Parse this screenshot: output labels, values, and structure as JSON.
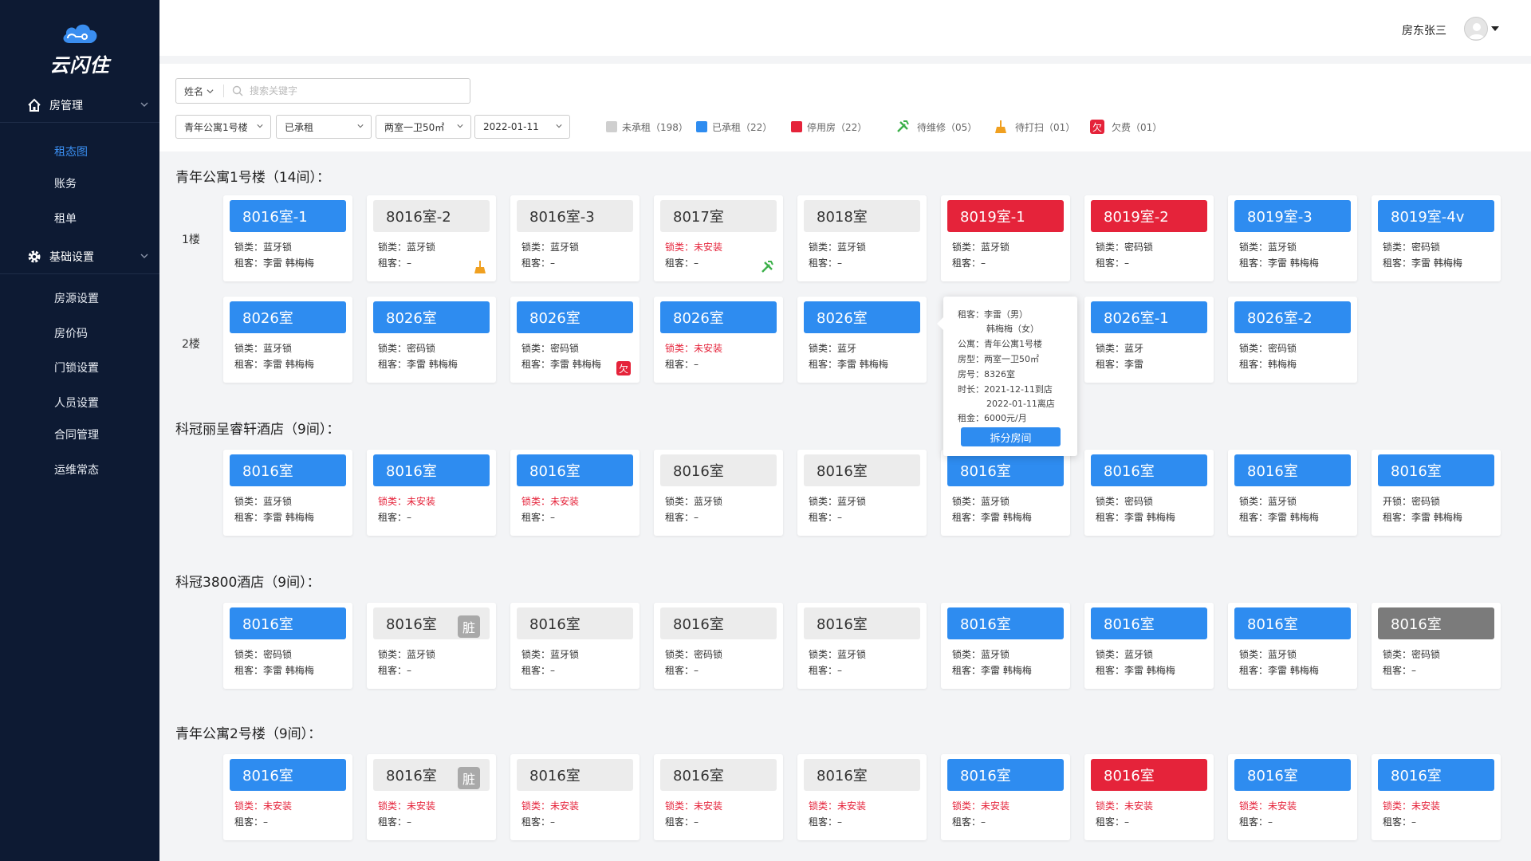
{
  "app": {
    "logo_text": "云闪住"
  },
  "sidebar": {
    "groups": [
      {
        "label": "房管理",
        "icon": "home-icon"
      },
      {
        "label": "基础设置",
        "icon": "gear-icon"
      }
    ],
    "room_items": [
      "租态图",
      "账务",
      "租单"
    ],
    "setting_items": [
      "房源设置",
      "房价码",
      "门锁设置",
      "人员设置",
      "合同管理",
      "运维常态"
    ]
  },
  "header": {
    "user": "房东张三"
  },
  "filters": {
    "search_type": "姓名",
    "search_placeholder": "搜索关键字",
    "selects": [
      "青年公寓1号楼",
      "已承租",
      "两室一卫50㎡",
      "2022-01-11"
    ],
    "legend": [
      {
        "label": "未承租（198）",
        "color": "#cfcfcf"
      },
      {
        "label": "已承租（22）",
        "color": "#2e8cf0"
      },
      {
        "label": "停用房（22）",
        "color": "#e5233a"
      },
      {
        "label": "待维修（05）",
        "icon": "tools-icon"
      },
      {
        "label": "待打扫（01）",
        "icon": "broom-icon"
      },
      {
        "label": "欠费（01）",
        "icon": "arrears-icon",
        "badge": "欠"
      }
    ]
  },
  "labels": {
    "lock": "锁类：",
    "tenant": "租客：",
    "open_lock": "开锁：",
    "floor1": "1楼",
    "floor2": "2楼",
    "dirty": "脏",
    "arrears": "欠"
  },
  "sections": [
    {
      "title": "青年公寓1号楼（14间）：",
      "floors": [
        {
          "rooms": [
            {
              "name": "8016室-1",
              "status": "blue",
              "lock": "蓝牙锁",
              "tenant": "李雷 韩梅梅"
            },
            {
              "name": "8016室-2",
              "status": "gray",
              "lock": "蓝牙锁",
              "tenant": "–",
              "icon": "broom-icon"
            },
            {
              "name": "8016室-3",
              "status": "gray",
              "lock": "蓝牙锁",
              "tenant": "–"
            },
            {
              "name": "8017室",
              "status": "gray",
              "lock": "未安装",
              "lock_warn": true,
              "tenant": "–",
              "icon": "tools-icon"
            },
            {
              "name": "8018室",
              "status": "gray",
              "lock": "蓝牙锁",
              "tenant": "–"
            },
            {
              "name": "8019室-1",
              "status": "red",
              "lock": "蓝牙锁",
              "tenant": "–"
            },
            {
              "name": "8019室-2",
              "status": "red",
              "lock": "密码锁",
              "tenant": "–"
            },
            {
              "name": "8019室-3",
              "status": "blue",
              "lock": "蓝牙锁",
              "tenant": "李雷 韩梅梅"
            },
            {
              "name": "8019室-4v",
              "status": "blue",
              "lock": "密码锁",
              "tenant": "李雷 韩梅梅"
            }
          ]
        },
        {
          "rooms": [
            {
              "name": "8026室",
              "status": "blue",
              "lock": "蓝牙锁",
              "tenant": "李雷 韩梅梅"
            },
            {
              "name": "8026室",
              "status": "blue",
              "lock": "密码锁",
              "tenant": "李雷 韩梅梅"
            },
            {
              "name": "8026室",
              "status": "blue",
              "lock": "密码锁",
              "tenant": "李雷 韩梅梅",
              "icon": "arrears-icon"
            },
            {
              "name": "8026室",
              "status": "blue",
              "lock": "未安装",
              "lock_warn": true,
              "tenant": "–"
            },
            {
              "name": "8026室",
              "status": "blue",
              "lock": "蓝牙",
              "tenant": "李雷 韩梅梅"
            },
            null,
            {
              "name": "8026室-1",
              "status": "blue",
              "lock": "蓝牙",
              "tenant": "李雷"
            },
            {
              "name": "8026室-2",
              "status": "blue",
              "lock": "密码锁",
              "tenant": "韩梅梅"
            }
          ]
        }
      ]
    },
    {
      "title": "科冠丽呈睿轩酒店（9间）：",
      "floors": [
        {
          "rooms": [
            {
              "name": "8016室",
              "status": "blue",
              "lock": "蓝牙锁",
              "tenant": "李雷 韩梅梅"
            },
            {
              "name": "8016室",
              "status": "blue",
              "lock": "未安装",
              "lock_warn": true,
              "tenant": "–"
            },
            {
              "name": "8016室",
              "status": "blue",
              "lock": "未安装",
              "lock_warn": true,
              "tenant": "–"
            },
            {
              "name": "8016室",
              "status": "gray",
              "lock": "蓝牙锁",
              "tenant": "–"
            },
            {
              "name": "8016室",
              "status": "gray",
              "lock": "蓝牙锁",
              "tenant": "–"
            },
            {
              "name": "8016室",
              "status": "blue",
              "lock": "蓝牙锁",
              "tenant": "李雷 韩梅梅"
            },
            {
              "name": "8016室",
              "status": "blue",
              "lock": "密码锁",
              "tenant": "李雷 韩梅梅"
            },
            {
              "name": "8016室",
              "status": "blue",
              "lock": "蓝牙锁",
              "tenant": "李雷 韩梅梅"
            },
            {
              "name": "8016室",
              "status": "blue",
              "lock": "密码锁",
              "tenant": "李雷 韩梅梅",
              "open": true
            }
          ]
        }
      ]
    },
    {
      "title": "科冠3800酒店（9间）：",
      "floors": [
        {
          "rooms": [
            {
              "name": "8016室",
              "status": "blue",
              "lock": "密码锁",
              "tenant": "李雷 韩梅梅"
            },
            {
              "name": "8016室",
              "status": "gray",
              "lock": "蓝牙锁",
              "tenant": "–",
              "dirty": true
            },
            {
              "name": "8016室",
              "status": "gray",
              "lock": "蓝牙锁",
              "tenant": "–"
            },
            {
              "name": "8016室",
              "status": "gray",
              "lock": "密码锁",
              "tenant": "–"
            },
            {
              "name": "8016室",
              "status": "gray",
              "lock": "蓝牙锁",
              "tenant": "–"
            },
            {
              "name": "8016室",
              "status": "blue",
              "lock": "蓝牙锁",
              "tenant": "李雷 韩梅梅"
            },
            {
              "name": "8016室",
              "status": "blue",
              "lock": "蓝牙锁",
              "tenant": "李雷 韩梅梅"
            },
            {
              "name": "8016室",
              "status": "blue",
              "lock": "蓝牙锁",
              "tenant": "李雷 韩梅梅"
            },
            {
              "name": "8016室",
              "status": "dark",
              "lock": "密码锁",
              "tenant": "–"
            }
          ]
        }
      ]
    },
    {
      "title": "青年公寓2号楼（9间）：",
      "floors": [
        {
          "rooms": [
            {
              "name": "8016室",
              "status": "blue",
              "lock": "未安装",
              "lock_warn": true,
              "tenant": "–"
            },
            {
              "name": "8016室",
              "status": "gray",
              "lock": "未安装",
              "lock_warn": true,
              "tenant": "–",
              "dirty": true
            },
            {
              "name": "8016室",
              "status": "gray",
              "lock": "未安装",
              "lock_warn": true,
              "tenant": "–"
            },
            {
              "name": "8016室",
              "status": "gray",
              "lock": "未安装",
              "lock_warn": true,
              "tenant": "–"
            },
            {
              "name": "8016室",
              "status": "gray",
              "lock": "未安装",
              "lock_warn": true,
              "tenant": "–"
            },
            {
              "name": "8016室",
              "status": "blue",
              "lock": "未安装",
              "lock_warn": true,
              "tenant": "–"
            },
            {
              "name": "8016室",
              "status": "red",
              "lock": "未安装",
              "lock_warn": true,
              "tenant": "–"
            },
            {
              "name": "8016室",
              "status": "blue",
              "lock": "未安装",
              "lock_warn": true,
              "tenant": "–"
            },
            {
              "name": "8016室",
              "status": "blue",
              "lock": "未安装",
              "lock_warn": true,
              "tenant": "–"
            }
          ]
        }
      ]
    }
  ],
  "popup": {
    "rows": [
      "租客：李雷（男）",
      "韩梅梅（女）",
      "公寓：青年公寓1号楼",
      "房型：两室一卫50㎡",
      "房号：8326室",
      "时长：2021-12-11到店",
      "2022-01-11离店",
      "租金：6000元/月"
    ],
    "button": "拆分房间"
  }
}
